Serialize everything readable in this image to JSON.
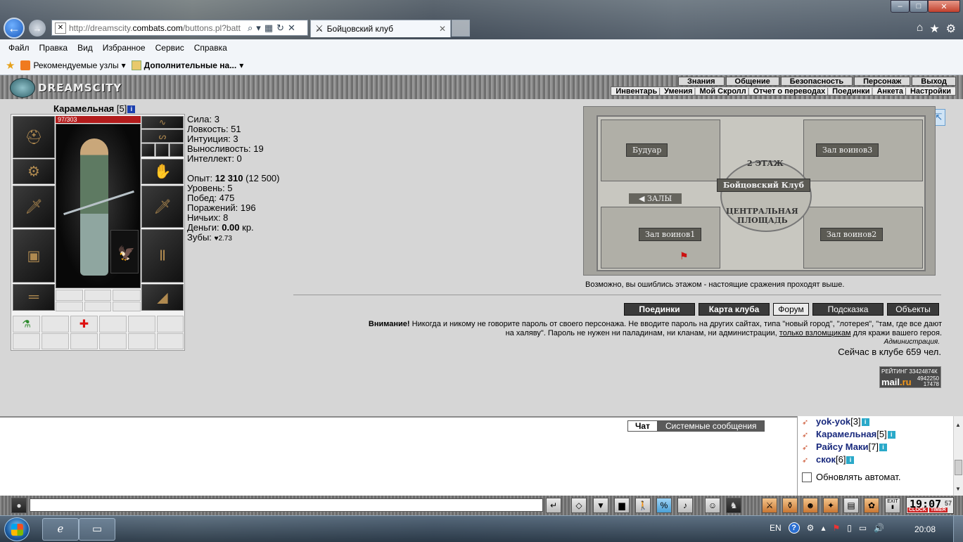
{
  "browser": {
    "url_prefix": "http://dreamscity.",
    "url_domain": "combats.com",
    "url_rest": "/buttons.pl?batt",
    "tab_title": "Бойцовский клуб",
    "menu": [
      "Файл",
      "Правка",
      "Вид",
      "Избранное",
      "Сервис",
      "Справка"
    ],
    "favorites": [
      "Рекомендуемые узлы",
      "Дополнительные на..."
    ]
  },
  "game": {
    "logo": "DREAMSCITY",
    "top_menu": [
      "Знания",
      "Общение",
      "Безопасность",
      "Персонаж",
      "Выход"
    ],
    "sub_menu": [
      "Инвентарь",
      "Умения",
      "Мой Скролл",
      "Отчет о переводах",
      "Поединки",
      "Анкета",
      "Настройки"
    ],
    "character": {
      "name": "Карамельная",
      "level_tag": "[5]",
      "hp": "97/303"
    },
    "stats": {
      "strength": "Сила: 3",
      "agility": "Ловкость: 51",
      "intuition": "Интуиция: 3",
      "endurance": "Выносливость: 19",
      "intellect": "Интеллект: 0",
      "exp_label": "Опыт: ",
      "exp_value": "12 310",
      "exp_next": " (12 500)",
      "level": "Уровень: 5",
      "wins": "Побед: 475",
      "losses": "Поражений: 196",
      "draws": "Ничьих: 8",
      "money_label": "Деньги: ",
      "money_value": "0.00",
      "money_unit": " кр.",
      "teeth_label": "Зубы: ",
      "teeth_value": "♥2.73"
    },
    "map": {
      "floor": "2 ЭТАЖ",
      "club": "Бойцовский Клуб",
      "square_line1": "ЦЕНТРАЛЬНАЯ",
      "square_line2": "ПЛОЩАДЬ",
      "halls": "ЗАЛЫ",
      "rooms": [
        "Будуар",
        "Зал воинов3",
        "Зал воинов1",
        "Зал воинов2"
      ],
      "note": "Возможно, вы ошиблись этажом - настоящие сражения проходят выше."
    },
    "buttons": [
      "Поединки",
      "Карта клуба",
      "Форум",
      "Подсказка",
      "Объекты"
    ],
    "warning": {
      "strong": "Внимание!",
      "line1": " Никогда и никому не говорите пароль от своего персонажа. Не вводите пароль на других сайтах, типа \"новый город\", \"лотерея\", \"там, где все дают",
      "line2a": "на халяву\". Пароль не нужен ни паладинам, ни кланам, ни администрации, ",
      "link": "только взломщикам",
      "line2b": " для кражи вашего героя.",
      "signature": "Администрация."
    },
    "online": "Сейчас в клубе 659 чел.",
    "counter": {
      "rating": "РЕЙТИНГ 33424874К",
      "brand_a": "mail",
      "brand_b": ".ru",
      "n1": "4942250",
      "n2": "17478"
    }
  },
  "chat": {
    "tabs": [
      "Чат",
      "Системные сообщения"
    ],
    "users": [
      {
        "name": "yok-yok",
        "level": "[3]"
      },
      {
        "name": "Карамельная",
        "level": "[5]"
      },
      {
        "name": "Райсу Маки",
        "level": "[7]"
      },
      {
        "name": "скок",
        "level": "[6]"
      }
    ],
    "auto_update": "Обновлять автомат."
  },
  "toolbar": {
    "clock_time": "19:07",
    "clock_sec": "57",
    "clock_label": "CLOCK",
    "timer_label": "TIMER",
    "exit_label": "EXIT"
  },
  "taskbar": {
    "lang": "EN",
    "time": "20:08"
  }
}
